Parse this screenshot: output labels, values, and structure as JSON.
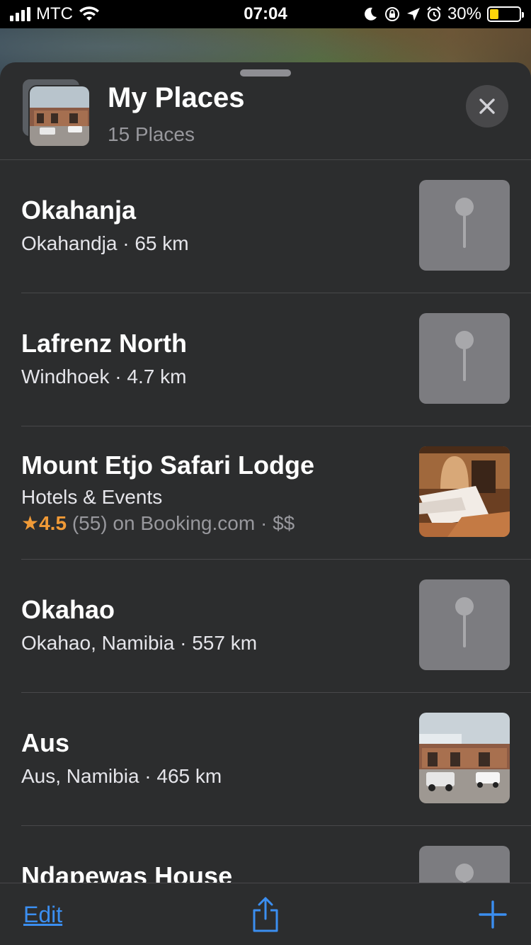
{
  "status_bar": {
    "carrier": "MTC",
    "time": "07:04",
    "battery_percent": "30%",
    "battery_level": 0.3
  },
  "sheet": {
    "title": "My Places",
    "subtitle": "15 Places",
    "close_icon": "close-icon"
  },
  "places": [
    {
      "name": "Okahanja",
      "detail": "Okahandja · 65 km",
      "thumbnail": "pin"
    },
    {
      "name": "Lafrenz North",
      "detail": "Windhoek · 4.7 km",
      "thumbnail": "pin"
    },
    {
      "name": "Mount Etjo Safari Lodge",
      "detail": "Hotels & Events",
      "rating_star": "★",
      "rating_score": "4.5",
      "rating_rest": " (55) on Booking.com · $$",
      "thumbnail": "photo-room"
    },
    {
      "name": "Okahao",
      "detail": "Okahao, Namibia · 557 km",
      "thumbnail": "pin"
    },
    {
      "name": "Aus",
      "detail": "Aus, Namibia · 465 km",
      "thumbnail": "photo-building"
    },
    {
      "name": "Ndapewas House",
      "detail": "",
      "thumbnail": "pin"
    }
  ],
  "toolbar": {
    "edit_label": "Edit",
    "share_icon": "share-icon",
    "add_icon": "plus-icon"
  },
  "colors": {
    "accent": "#3b8ef0",
    "rating": "#f09a37",
    "sheet_bg": "#2c2d2e",
    "battery_low": "#ffd60a"
  }
}
